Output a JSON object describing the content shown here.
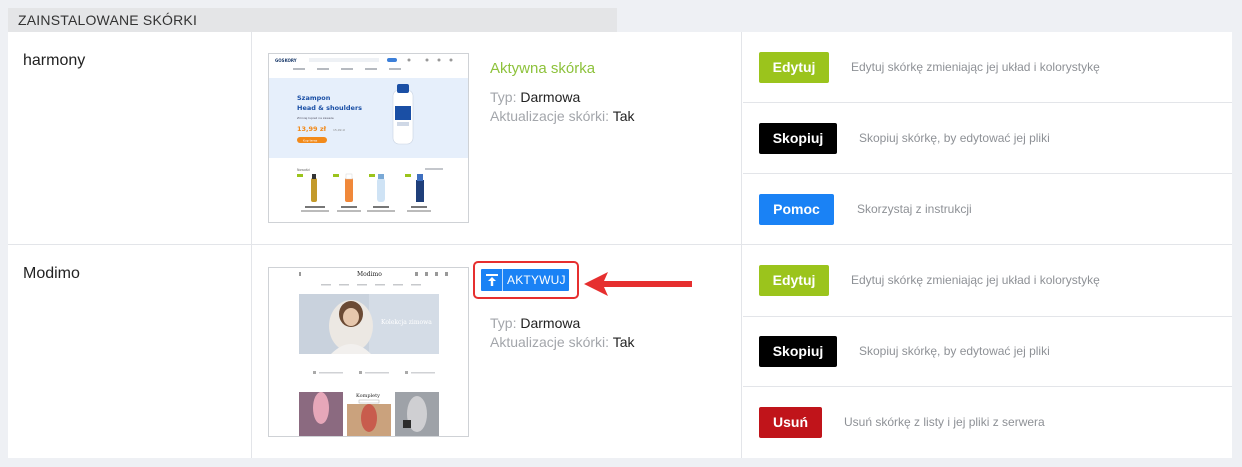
{
  "section": {
    "title": "ZAINSTALOWANE SKÓRKI"
  },
  "labels": {
    "type": "Typ:",
    "updates": "Aktualizacje skórki:"
  },
  "skins": [
    {
      "name": "harmony",
      "status": "Aktywna skórka",
      "type": "Darmowa",
      "updates": "Tak",
      "preview": {
        "brand": "GOSKORY",
        "banner_title_1": "Szampon",
        "banner_title_2": "Head & shoulders",
        "banner_sub": "Zmniej łupież na zawsze",
        "price": "13,99 zł",
        "old_price": "15,99 zł",
        "cta": "Kup teraz",
        "section": "Nowości"
      },
      "actions": [
        {
          "label": "Edytuj",
          "desc": "Edytuj skórkę zmieniając jej układ i kolorystykę",
          "color": "#9bc41c"
        },
        {
          "label": "Skopiuj",
          "desc": "Skopiuj skórkę, by edytować jej pliki",
          "color": "#000000"
        },
        {
          "label": "Pomoc",
          "desc": "Skorzystaj z instrukcji",
          "color": "#1a82f5"
        }
      ]
    },
    {
      "name": "Modimo",
      "activate_label": "AKTYWUJ",
      "type": "Darmowa",
      "updates": "Tak",
      "preview": {
        "brand": "Modimo",
        "banner": "Kolekcja zimowa",
        "section": "Komplety"
      },
      "actions": [
        {
          "label": "Edytuj",
          "desc": "Edytuj skórkę zmieniając jej układ i kolorystykę",
          "color": "#9bc41c"
        },
        {
          "label": "Skopiuj",
          "desc": "Skopiuj skórkę, by edytować jej pliki",
          "color": "#000000"
        },
        {
          "label": "Usuń",
          "desc": "Usuń skórkę z listy i jej pliki z serwera",
          "color": "#c0141a"
        }
      ]
    }
  ],
  "colors": {
    "active_status": "#8dc23b",
    "highlight": "#e62f2f",
    "accent": "#1a82f5"
  }
}
